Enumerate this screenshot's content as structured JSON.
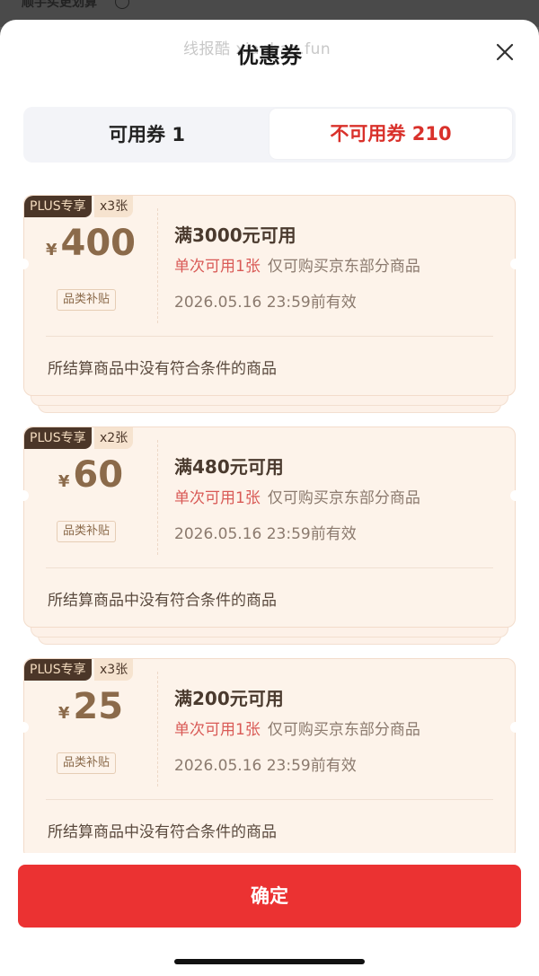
{
  "background": {
    "top_text": "顺手买更划算"
  },
  "header": {
    "watermark": "线报酷 xianbao.fun",
    "title": "优惠券"
  },
  "tabs": {
    "available_label": "可用券 1",
    "unavailable_label": "不可用券 210",
    "active": "unavailable"
  },
  "coupons": [
    {
      "plus_badge": "PLUS专享",
      "count_badge": "x3张",
      "currency": "¥",
      "amount": "400",
      "category_tag": "品类补贴",
      "condition": "满3000元可用",
      "limit_red": "单次可用1张",
      "limit_gray": "仅可购买京东部分商品",
      "expiry": "2026.05.16 23:59前有效",
      "reason": "所结算商品中没有符合条件的商品"
    },
    {
      "plus_badge": "PLUS专享",
      "count_badge": "x2张",
      "currency": "¥",
      "amount": "60",
      "category_tag": "品类补贴",
      "condition": "满480元可用",
      "limit_red": "单次可用1张",
      "limit_gray": "仅可购买京东部分商品",
      "expiry": "2026.05.16 23:59前有效",
      "reason": "所结算商品中没有符合条件的商品"
    },
    {
      "plus_badge": "PLUS专享",
      "count_badge": "x3张",
      "currency": "¥",
      "amount": "25",
      "category_tag": "品类补贴",
      "condition": "满200元可用",
      "limit_red": "单次可用1张",
      "limit_gray": "仅可购买京东部分商品",
      "expiry": "2026.05.16 23:59前有效",
      "reason": "所结算商品中没有符合条件的商品"
    }
  ],
  "footer": {
    "confirm_label": "确定"
  },
  "colors": {
    "accent_red": "#eb3232",
    "tab_active_red": "#d9312b",
    "coupon_bg": "#fdf3ea",
    "plus_badge_bg": "#4b3628"
  },
  "icons": {
    "close": "close-icon",
    "info": "info-icon"
  }
}
